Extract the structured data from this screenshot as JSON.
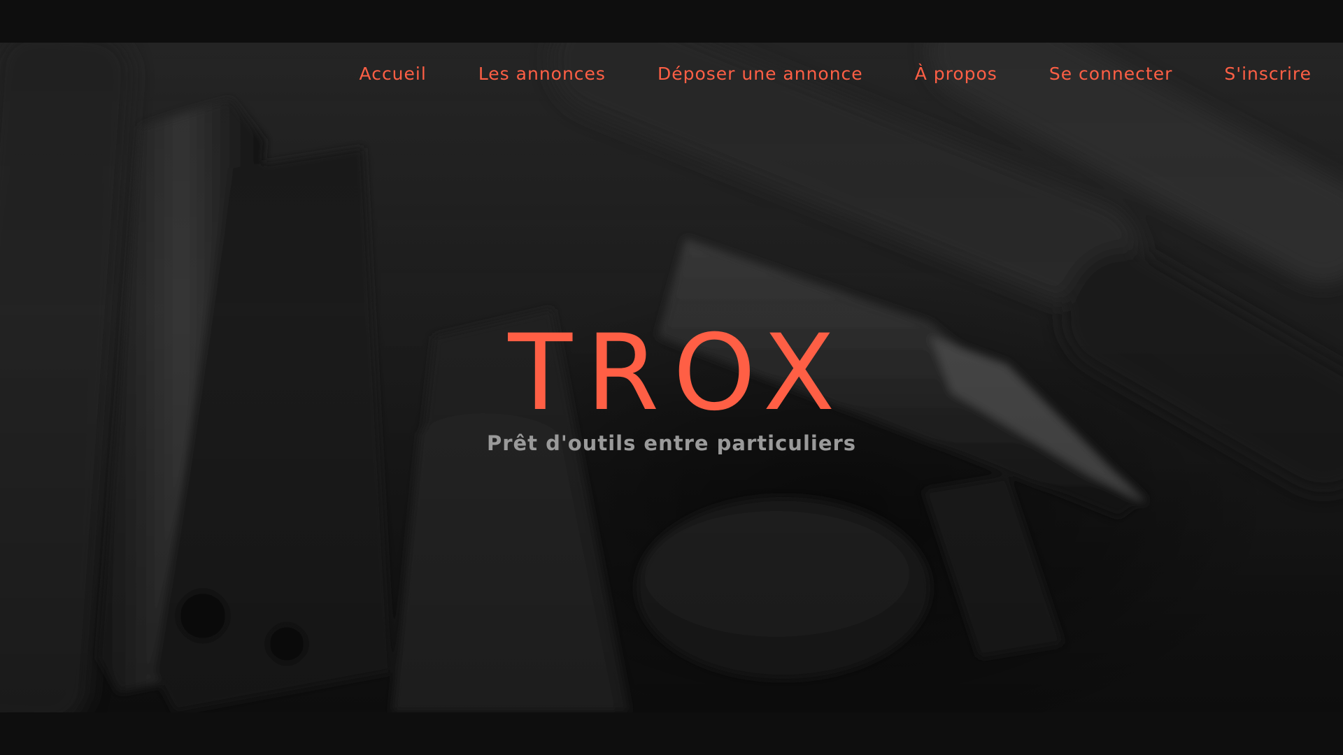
{
  "nav": {
    "items": [
      {
        "label": "Accueil"
      },
      {
        "label": "Les annonces"
      },
      {
        "label": "Déposer une annonce"
      },
      {
        "label": "À propos"
      },
      {
        "label": "Se connecter"
      },
      {
        "label": "S'inscrire"
      }
    ]
  },
  "hero": {
    "title": "TROX",
    "tagline": "Prêt d'outils entre particuliers",
    "background_image": "dark-tools-photo"
  },
  "colors": {
    "accent": "#ff5f45",
    "tagline": "#9a9a9a",
    "frame": "#0e0e0e"
  }
}
